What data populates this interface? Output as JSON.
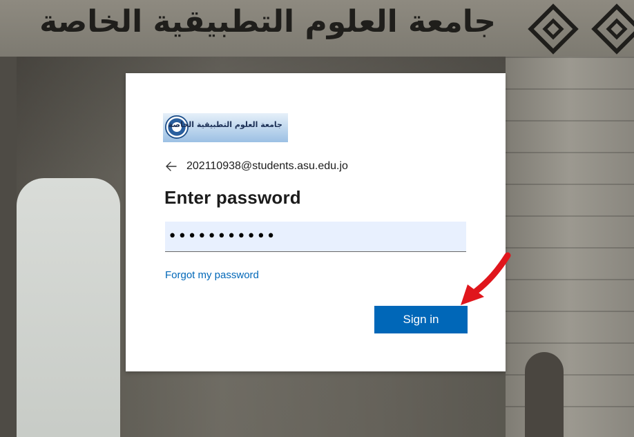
{
  "background": {
    "banner_text": "جامعة العلوم التطبيقية الخاصة"
  },
  "logo": {
    "text": "جامعة العلوم التطبيقية الخاصة"
  },
  "identity": {
    "email": "202110938@students.asu.edu.jo"
  },
  "login": {
    "title": "Enter password",
    "password_value": "•••••••••••",
    "forgot_label": "Forgot my password",
    "signin_label": "Sign in"
  },
  "colors": {
    "accent": "#0067b8",
    "input_background": "#e8f0fe",
    "annotation_arrow": "#e0161c"
  },
  "icons": {
    "back": "arrow-left-icon",
    "annotation": "red-arrow-pointer"
  }
}
